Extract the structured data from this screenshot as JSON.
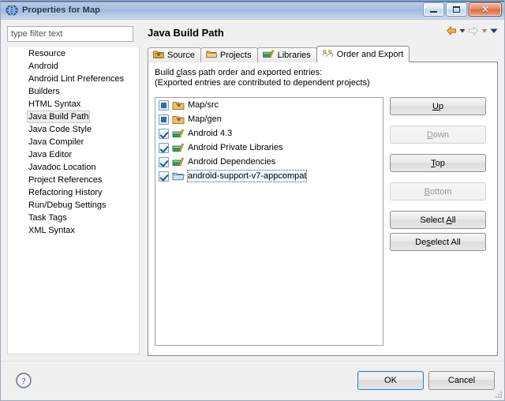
{
  "window": {
    "title": "Properties for Map",
    "icon": "globe-icon",
    "minimize_label": "–",
    "maximize_label": "□",
    "close_label": "✕"
  },
  "filter": {
    "value": "",
    "placeholder": "type filter text"
  },
  "sidebar": {
    "items": [
      {
        "label": "Resource",
        "selected": false
      },
      {
        "label": "Android",
        "selected": false
      },
      {
        "label": "Android Lint Preferences",
        "selected": false
      },
      {
        "label": "Builders",
        "selected": false
      },
      {
        "label": "HTML Syntax",
        "selected": false
      },
      {
        "label": "Java Build Path",
        "selected": true
      },
      {
        "label": "Java Code Style",
        "selected": false
      },
      {
        "label": "Java Compiler",
        "selected": false
      },
      {
        "label": "Java Editor",
        "selected": false
      },
      {
        "label": "Javadoc Location",
        "selected": false
      },
      {
        "label": "Project References",
        "selected": false
      },
      {
        "label": "Refactoring History",
        "selected": false
      },
      {
        "label": "Run/Debug Settings",
        "selected": false
      },
      {
        "label": "Task Tags",
        "selected": false
      },
      {
        "label": "XML Syntax",
        "selected": false
      }
    ]
  },
  "page": {
    "title": "Java Build Path",
    "nav": {
      "back": "back-arrow-icon",
      "back_menu": "back-dropdown-icon",
      "forward": "forward-arrow-icon",
      "forward_menu": "forward-dropdown-icon",
      "view_menu": "view-menu-icon"
    }
  },
  "tabs": [
    {
      "label": "Source",
      "icon": "source-folder-icon",
      "active": false
    },
    {
      "label": "Projects",
      "icon": "projects-folder-icon",
      "active": false
    },
    {
      "label": "Libraries",
      "icon": "libraries-books-icon",
      "active": false
    },
    {
      "label": "Order and Export",
      "icon": "order-export-icon",
      "active": true
    }
  ],
  "panel": {
    "description_line1": "Build class path order and exported entries:",
    "description_line1_mnemonic": "c",
    "description_line2": "(Exported entries are contributed to dependent projects)"
  },
  "entries": [
    {
      "label": "Map/src",
      "icon": "package-folder-icon",
      "checkbox": "filled",
      "focused": false
    },
    {
      "label": "Map/gen",
      "icon": "package-folder-icon",
      "checkbox": "filled",
      "focused": false
    },
    {
      "label": "Android 4.3",
      "icon": "library-books-icon",
      "checkbox": "checked",
      "focused": false
    },
    {
      "label": "Android Private Libraries",
      "icon": "library-books-icon",
      "checkbox": "checked",
      "focused": false
    },
    {
      "label": "Android Dependencies",
      "icon": "library-books-icon",
      "checkbox": "checked",
      "focused": false
    },
    {
      "label": "android-support-v7-appcompat",
      "icon": "blue-folder-icon",
      "checkbox": "checked",
      "focused": true
    }
  ],
  "side_buttons": [
    {
      "label": "Up",
      "mnemonic": "U",
      "enabled": true
    },
    {
      "label": "Down",
      "mnemonic": "D",
      "enabled": false
    },
    {
      "label": "Top",
      "mnemonic": "T",
      "enabled": true
    },
    {
      "label": "Bottom",
      "mnemonic": "B",
      "enabled": false
    },
    {
      "label": "Select All",
      "mnemonic": "A",
      "enabled": true
    },
    {
      "label": "Deselect All",
      "mnemonic": "s",
      "enabled": true
    }
  ],
  "footer": {
    "help_icon": "help-question-icon",
    "ok_label": "OK",
    "cancel_label": "Cancel"
  },
  "colors": {
    "titlebar_blue": "#4b6b9c",
    "accent_selection": "#3c7fb1",
    "checkbox_blue": "#1c5a9e",
    "back_arrow": "#e8a33d",
    "forward_arrow_disabled": "#cfcfcf"
  }
}
